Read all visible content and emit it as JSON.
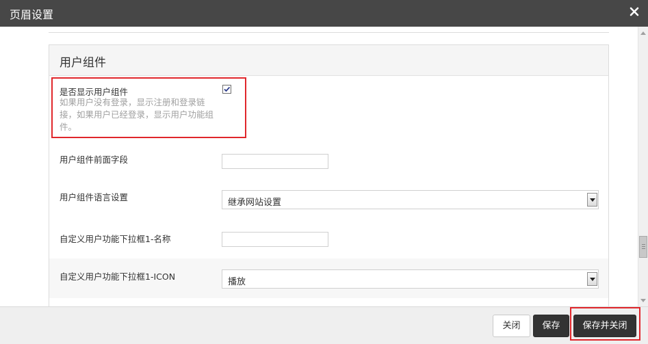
{
  "dialog": {
    "title": "页眉设置"
  },
  "section": {
    "title": "用户组件"
  },
  "fields": {
    "show_user_component": {
      "label": "是否显示用户组件",
      "help": "如果用户没有登录，显示注册和登录链接，如果用户已经登录，显示用户功能组件。",
      "checked": true
    },
    "prefix_field": {
      "label": "用户组件前面字段",
      "value": ""
    },
    "language": {
      "label": "用户组件语言设置",
      "selected": "继承网站设置"
    },
    "dropdown1_name": {
      "label": "自定义用户功能下拉框1-名称",
      "value": ""
    },
    "dropdown1_icon": {
      "label": "自定义用户功能下拉框1-ICON",
      "selected": "播放"
    }
  },
  "footer": {
    "close_label": "关闭",
    "save_label": "保存",
    "save_close_label": "保存并关闭"
  },
  "colors": {
    "titlebar": "#474747",
    "highlight": "#e0262b",
    "dark_button": "#333333"
  }
}
